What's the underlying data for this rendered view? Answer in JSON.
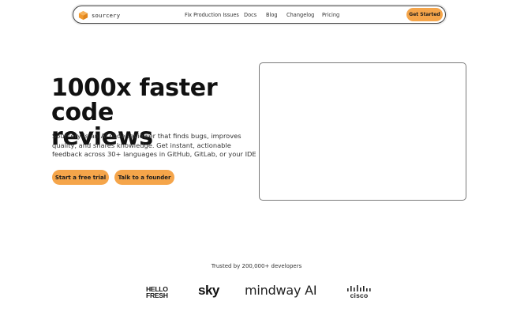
{
  "nav": {
    "brand": "sourcery",
    "links": [
      "Fix Production Issues",
      "Docs",
      "Blog",
      "Changelog",
      "Pricing"
    ],
    "cta": "Get Started"
  },
  "hero": {
    "title_line1": "1000x faster code",
    "title_line2": "reviews",
    "description": "Sourcery is an AI code reviewer that finds bugs, improves quality, and shares knowledge. Get instant, actionable feedback across 30+ languages in GitHub, GitLab, or your IDE",
    "primary_cta": "Start a free trial",
    "secondary_cta": "Talk to a founder"
  },
  "trust": {
    "text": "Trusted by 200,000+ developers",
    "logos": [
      {
        "name": "hellofresh-logo",
        "line1": "HELLO",
        "line2": "FRESH"
      },
      {
        "name": "sky-logo",
        "text": "sky"
      },
      {
        "name": "mindway-ai-logo",
        "text": "mindway AI"
      },
      {
        "name": "cisco-logo",
        "text": "cisco"
      }
    ]
  },
  "colors": {
    "accent": "#f5a54a",
    "text": "#111111",
    "border": "#444444"
  }
}
